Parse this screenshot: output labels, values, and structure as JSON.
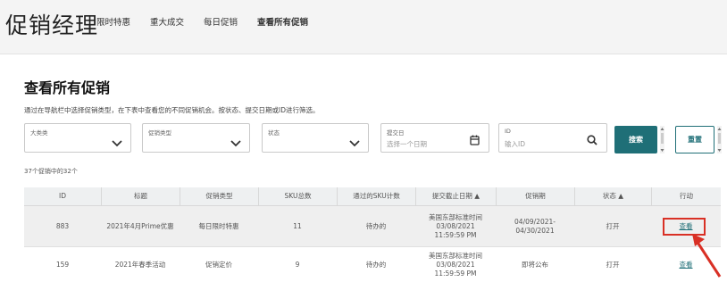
{
  "header": {
    "title": "促销经理",
    "tabs": [
      {
        "label": "限时特惠"
      },
      {
        "label": "重大成交"
      },
      {
        "label": "每日促销"
      },
      {
        "label": "查看所有促销"
      }
    ]
  },
  "main": {
    "title": "查看所有促销",
    "description": "通过在导航栏中选择促销类型，在下表中查看您的不同促销机会。按状态、提交日期或ID进行筛选。"
  },
  "filters": {
    "category": {
      "label": "大类类",
      "value": ""
    },
    "promo_type": {
      "label": "促销类型",
      "value": ""
    },
    "status": {
      "label": "状态",
      "value": ""
    },
    "date": {
      "label": "提交日",
      "placeholder": "选择一个日期"
    },
    "id": {
      "label": "ID",
      "placeholder": "输入ID"
    },
    "search_button": "搜索",
    "reset_button": "重置"
  },
  "result_count": "37个促销中的32个",
  "table": {
    "columns": [
      "ID",
      "标题",
      "促销类型",
      "SKU总数",
      "通过的SKU计数",
      "提交截止日期 ▲",
      "促销期",
      "状态 ▲",
      "行动"
    ],
    "rows": [
      {
        "id": "883",
        "title": "2021年4月Prime优惠",
        "type": "每日限时特惠",
        "sku_total": "11",
        "passed": "待办的",
        "deadline": "美国东部标准时间\n03/08/2021\n11:59:59 PM",
        "period": "04/09/2021-\n04/30/2021",
        "status": "打开",
        "action": "查看"
      },
      {
        "id": "159",
        "title": "2021年春季活动",
        "type": "促销定价",
        "sku_total": "9",
        "passed": "待办的",
        "deadline": "美国东部标准时间\n03/08/2021\n11:59:59 PM",
        "period": "即将公布",
        "status": "打开",
        "action": "查看"
      }
    ]
  },
  "colors": {
    "accent": "#1f6f77",
    "highlight": "#d93025"
  },
  "icons": [
    "chevron-down-icon",
    "calendar-icon",
    "search-icon",
    "arrow-icon"
  ]
}
